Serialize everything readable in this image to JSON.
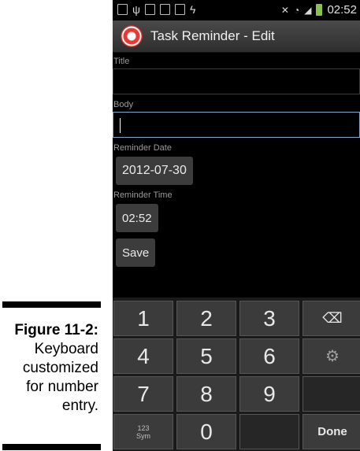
{
  "caption": {
    "title": "Figure 11-2:",
    "lines": [
      "Keyboard",
      "customized",
      "for number",
      "entry."
    ]
  },
  "statusbar": {
    "time": "02:52"
  },
  "app": {
    "title": "Task Reminder - Edit"
  },
  "form": {
    "title_label": "Title",
    "title_value": "",
    "body_label": "Body",
    "body_value": "",
    "date_label": "Reminder Date",
    "date_value": "2012-07-30",
    "time_label": "Reminder Time",
    "time_value": "02:52",
    "save_label": "Save"
  },
  "keyboard": {
    "rows": [
      [
        "1",
        "2",
        "3",
        "⌫"
      ],
      [
        "4",
        "5",
        "6",
        "⚙"
      ],
      [
        "7",
        "8",
        "9",
        ""
      ],
      [
        "123 Sym",
        "0",
        "",
        "Done"
      ]
    ],
    "sym_top": "123",
    "sym_bottom": "Sym"
  },
  "colors": {
    "screen_bg": "#000000",
    "focus_border": "#7fa6c9",
    "key_bg": "#3b3b3b"
  }
}
